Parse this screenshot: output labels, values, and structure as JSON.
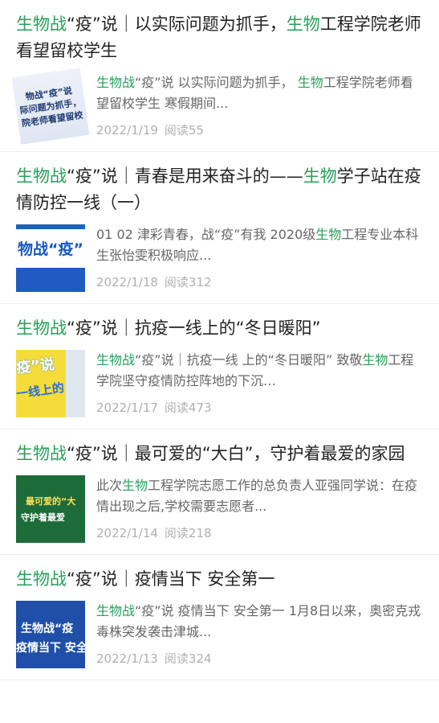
{
  "articles": [
    {
      "title_prefix": "生物战",
      "title_mid": "“疫”说｜以实际问题为抓手，",
      "title_hl": "生物",
      "title_suffix": "工程学院老师看望留校学生",
      "summary_hl": "生物战",
      "summary_text": "“疫”说 以实际问题为抓手， ",
      "summary_hl2": "生物",
      "summary_text2": "工程学院老师看望留校学生 寒假期间...",
      "thumb_line1": "物战“疫”说",
      "thumb_line2": "际问题为抓手，",
      "thumb_line3": "院老师看望留校",
      "date": "2022/1/19",
      "reads": "阅读55"
    },
    {
      "title_prefix": "生物战",
      "title_mid": "“疫”说｜青春是用来奋斗的——",
      "title_hl": "生物",
      "title_suffix": "学子站在疫情防控一线（一）",
      "summary_hl": "",
      "summary_text": "01 02 津彩青春，战“疫”有我 2020级",
      "summary_hl2": "生物",
      "summary_text2": "工程专业本科生张怡雯积极响应...",
      "thumb_line1": "物战“疫”",
      "thumb_line2": "",
      "thumb_line3": "",
      "date": "2022/1/18",
      "reads": "阅读312"
    },
    {
      "title_prefix": "生物战",
      "title_mid": "“疫”说｜抗疫一线上的“冬日暖阳”",
      "title_hl": "",
      "title_suffix": "",
      "summary_hl": "生物战",
      "summary_text": "“疫”说｜抗疫一线 上的“冬日暖阳” 致敬",
      "summary_hl2": "生物",
      "summary_text2": "工程学院坚守疫情防控阵地的下沉…",
      "thumb_line1": "疫”说",
      "thumb_line2": "一线上的",
      "thumb_line3": "",
      "date": "2022/1/17",
      "reads": "阅读473"
    },
    {
      "title_prefix": "生物战",
      "title_mid": "“疫”说｜最可爱的“大白”，守护着最爱的家园",
      "title_hl": "",
      "title_suffix": "",
      "summary_hl": "",
      "summary_text": "此次",
      "summary_hl2": "生物",
      "summary_text2": "工程学院志愿工作的总负责人亚强同学说：在疫情出现之后,学校需要志愿者...",
      "thumb_line1": "最可爱的“大",
      "thumb_line2": "守护着最爱",
      "thumb_line3": "",
      "date": "2022/1/14",
      "reads": "阅读218"
    },
    {
      "title_prefix": "生物战",
      "title_mid": "“疫”说｜疫情当下 安全第一",
      "title_hl": "",
      "title_suffix": "",
      "summary_hl": "生物战",
      "summary_text": "“疫”说 疫情当下 安全第一 1月8日以来，奥密克戎毒株突发袭击津城...",
      "summary_hl2": "",
      "summary_text2": "",
      "thumb_line1": "生物战“疫",
      "thumb_line2": "疫情当下 安全",
      "thumb_line3": "",
      "date": "2022/1/13",
      "reads": "阅读324"
    }
  ],
  "colors": {
    "highlight": "#24a05a",
    "meta": "#b0b0b0",
    "summary": "#666666"
  }
}
